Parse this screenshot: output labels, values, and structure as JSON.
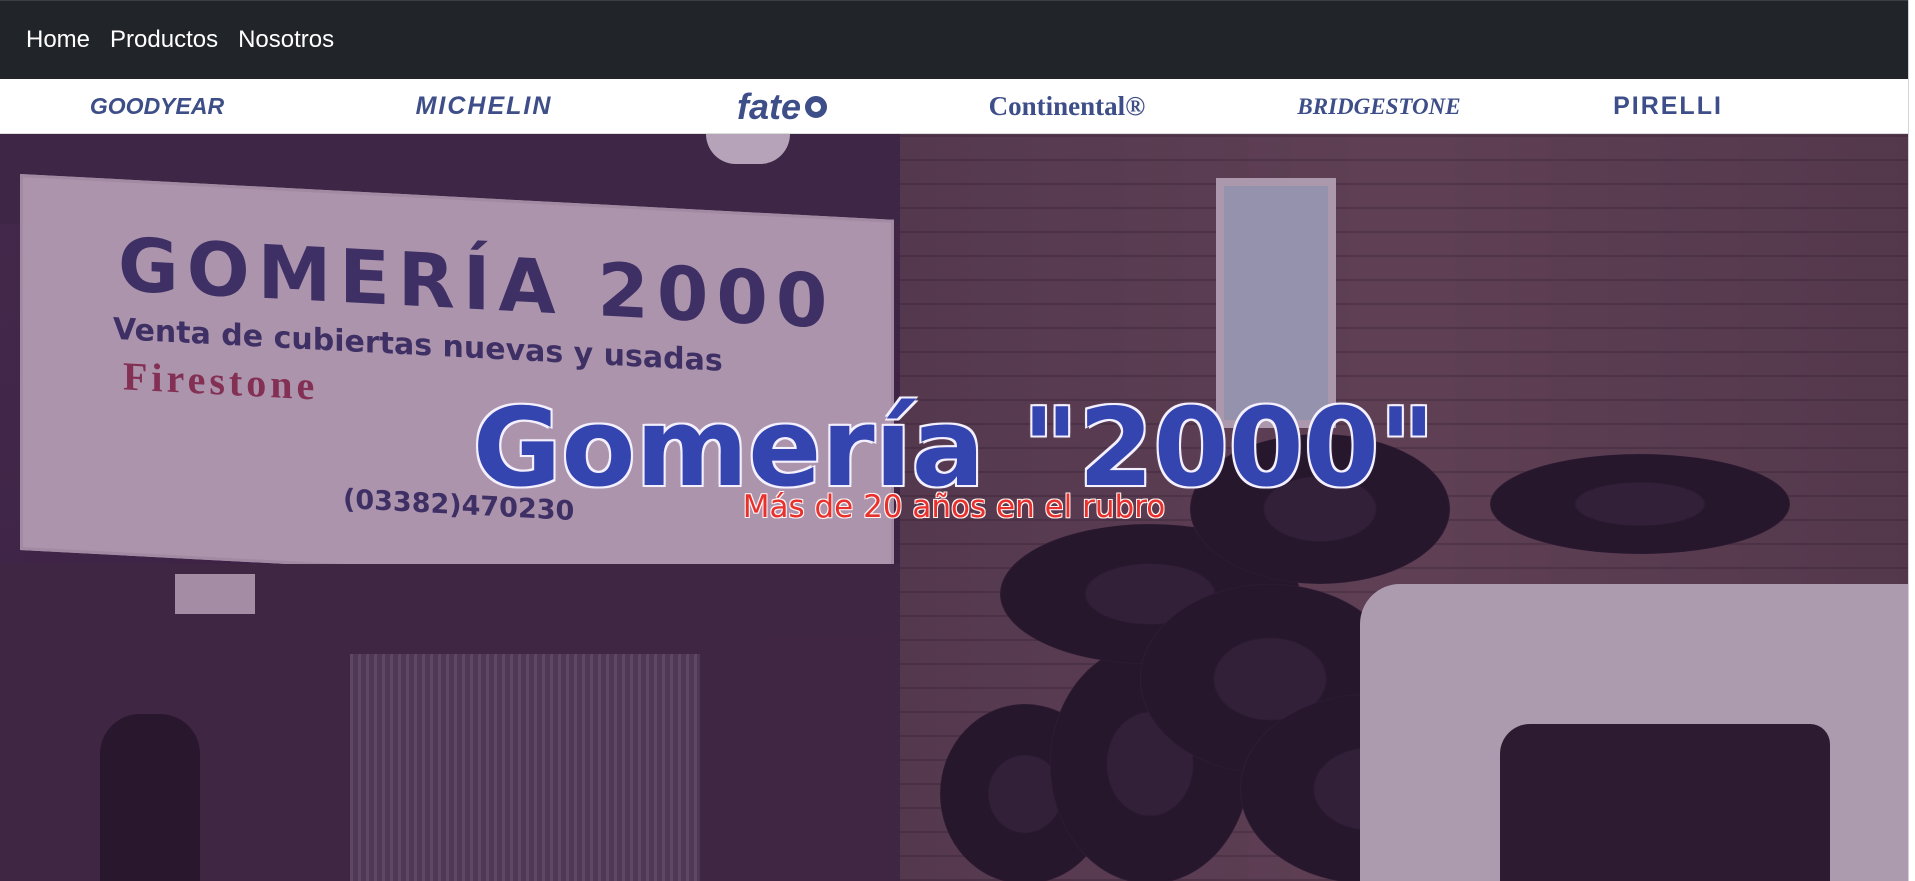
{
  "nav": {
    "items": [
      {
        "label": "Home"
      },
      {
        "label": "Productos"
      },
      {
        "label": "Nosotros"
      }
    ]
  },
  "brands": {
    "goodyear": "GOODYEAR",
    "michelin": "MICHELIN",
    "fate": "fate",
    "continental": "Continental®",
    "bridgestone": "BRIDGESTONE",
    "pirelli": "PIRELLI"
  },
  "hero": {
    "title": "Gomería \"2000\"",
    "subtitle": "Más de 20 años en el rubro",
    "banner": {
      "title": "GOMERÍA 2000",
      "subtitle": "Venta de cubiertas nuevas y usadas",
      "brand": "Firestone",
      "phone": "(03382)470230"
    }
  },
  "colors": {
    "navbar_bg": "#212529",
    "title_blue": "#3545b0",
    "subtitle_red": "#e8302c",
    "brand_blue": "#3d4e88"
  }
}
